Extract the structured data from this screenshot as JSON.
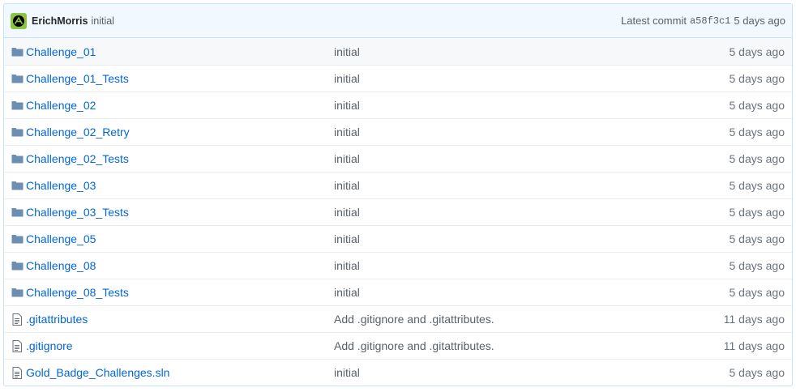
{
  "commit": {
    "author": "ErichMorris",
    "message": "initial",
    "latest_label": "Latest commit",
    "sha": "a58f3c1",
    "age": "5 days ago"
  },
  "files": [
    {
      "type": "folder",
      "name": "Challenge_01",
      "message": "initial",
      "age": "5 days ago"
    },
    {
      "type": "folder",
      "name": "Challenge_01_Tests",
      "message": "initial",
      "age": "5 days ago"
    },
    {
      "type": "folder",
      "name": "Challenge_02",
      "message": "initial",
      "age": "5 days ago"
    },
    {
      "type": "folder",
      "name": "Challenge_02_Retry",
      "message": "initial",
      "age": "5 days ago"
    },
    {
      "type": "folder",
      "name": "Challenge_02_Tests",
      "message": "initial",
      "age": "5 days ago"
    },
    {
      "type": "folder",
      "name": "Challenge_03",
      "message": "initial",
      "age": "5 days ago"
    },
    {
      "type": "folder",
      "name": "Challenge_03_Tests",
      "message": "initial",
      "age": "5 days ago"
    },
    {
      "type": "folder",
      "name": "Challenge_05",
      "message": "initial",
      "age": "5 days ago"
    },
    {
      "type": "folder",
      "name": "Challenge_08",
      "message": "initial",
      "age": "5 days ago"
    },
    {
      "type": "folder",
      "name": "Challenge_08_Tests",
      "message": "initial",
      "age": "5 days ago"
    },
    {
      "type": "file",
      "name": ".gitattributes",
      "message": "Add .gitignore and .gitattributes.",
      "age": "11 days ago"
    },
    {
      "type": "file",
      "name": ".gitignore",
      "message": "Add .gitignore and .gitattributes.",
      "age": "11 days ago"
    },
    {
      "type": "file",
      "name": "Gold_Badge_Challenges.sln",
      "message": "initial",
      "age": "5 days ago"
    }
  ],
  "colors": {
    "link": "#0366d6",
    "folder_icon": "#79b8ff",
    "commit_bar_bg": "#f1f8ff",
    "avatar_bg": "#8cc63f"
  }
}
